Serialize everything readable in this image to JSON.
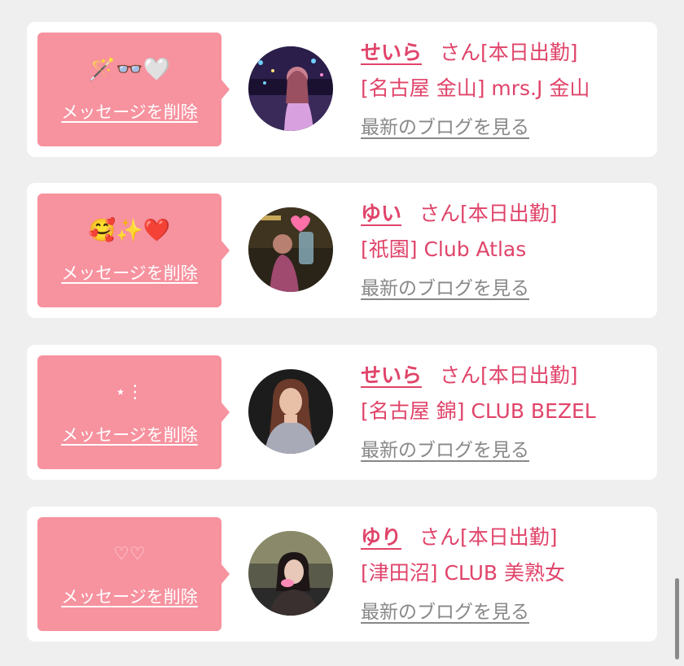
{
  "cards": [
    {
      "message": "🪄👓🤍",
      "delete_label": "メッセージを削除",
      "name": "せいら",
      "honorific": "さん",
      "status": "[本日出勤]",
      "store": "[名古屋 金山] mrs.J 金山",
      "blog_label": "最新のブログを見る",
      "avatar_theme": "night-view"
    },
    {
      "message": "🥰✨❤️",
      "delete_label": "メッセージを削除",
      "name": "ゆい",
      "honorific": "さん",
      "status": "[本日出勤]",
      "store": "[祇園] Club Atlas",
      "blog_label": "最新のブログを見る",
      "avatar_theme": "club-interior"
    },
    {
      "message": "⋆⋮",
      "delete_label": "メッセージを削除",
      "name": "せいら",
      "honorific": "さん",
      "status": "[本日出勤]",
      "store": "[名古屋 錦] CLUB BEZEL",
      "blog_label": "最新のブログを見る",
      "avatar_theme": "portrait-dark"
    },
    {
      "message": "♡♡",
      "delete_label": "メッセージを削除",
      "name": "ゆり",
      "honorific": "さん",
      "status": "[本日出勤]",
      "store": "[津田沼] CLUB 美熟女",
      "blog_label": "最新のブログを見る",
      "avatar_theme": "bar-counter"
    }
  ],
  "colors": {
    "page_bg": "#efefef",
    "card_bg": "#ffffff",
    "bubble": "#f7929f",
    "accent": "#e0446a",
    "link_gray": "#888888"
  }
}
